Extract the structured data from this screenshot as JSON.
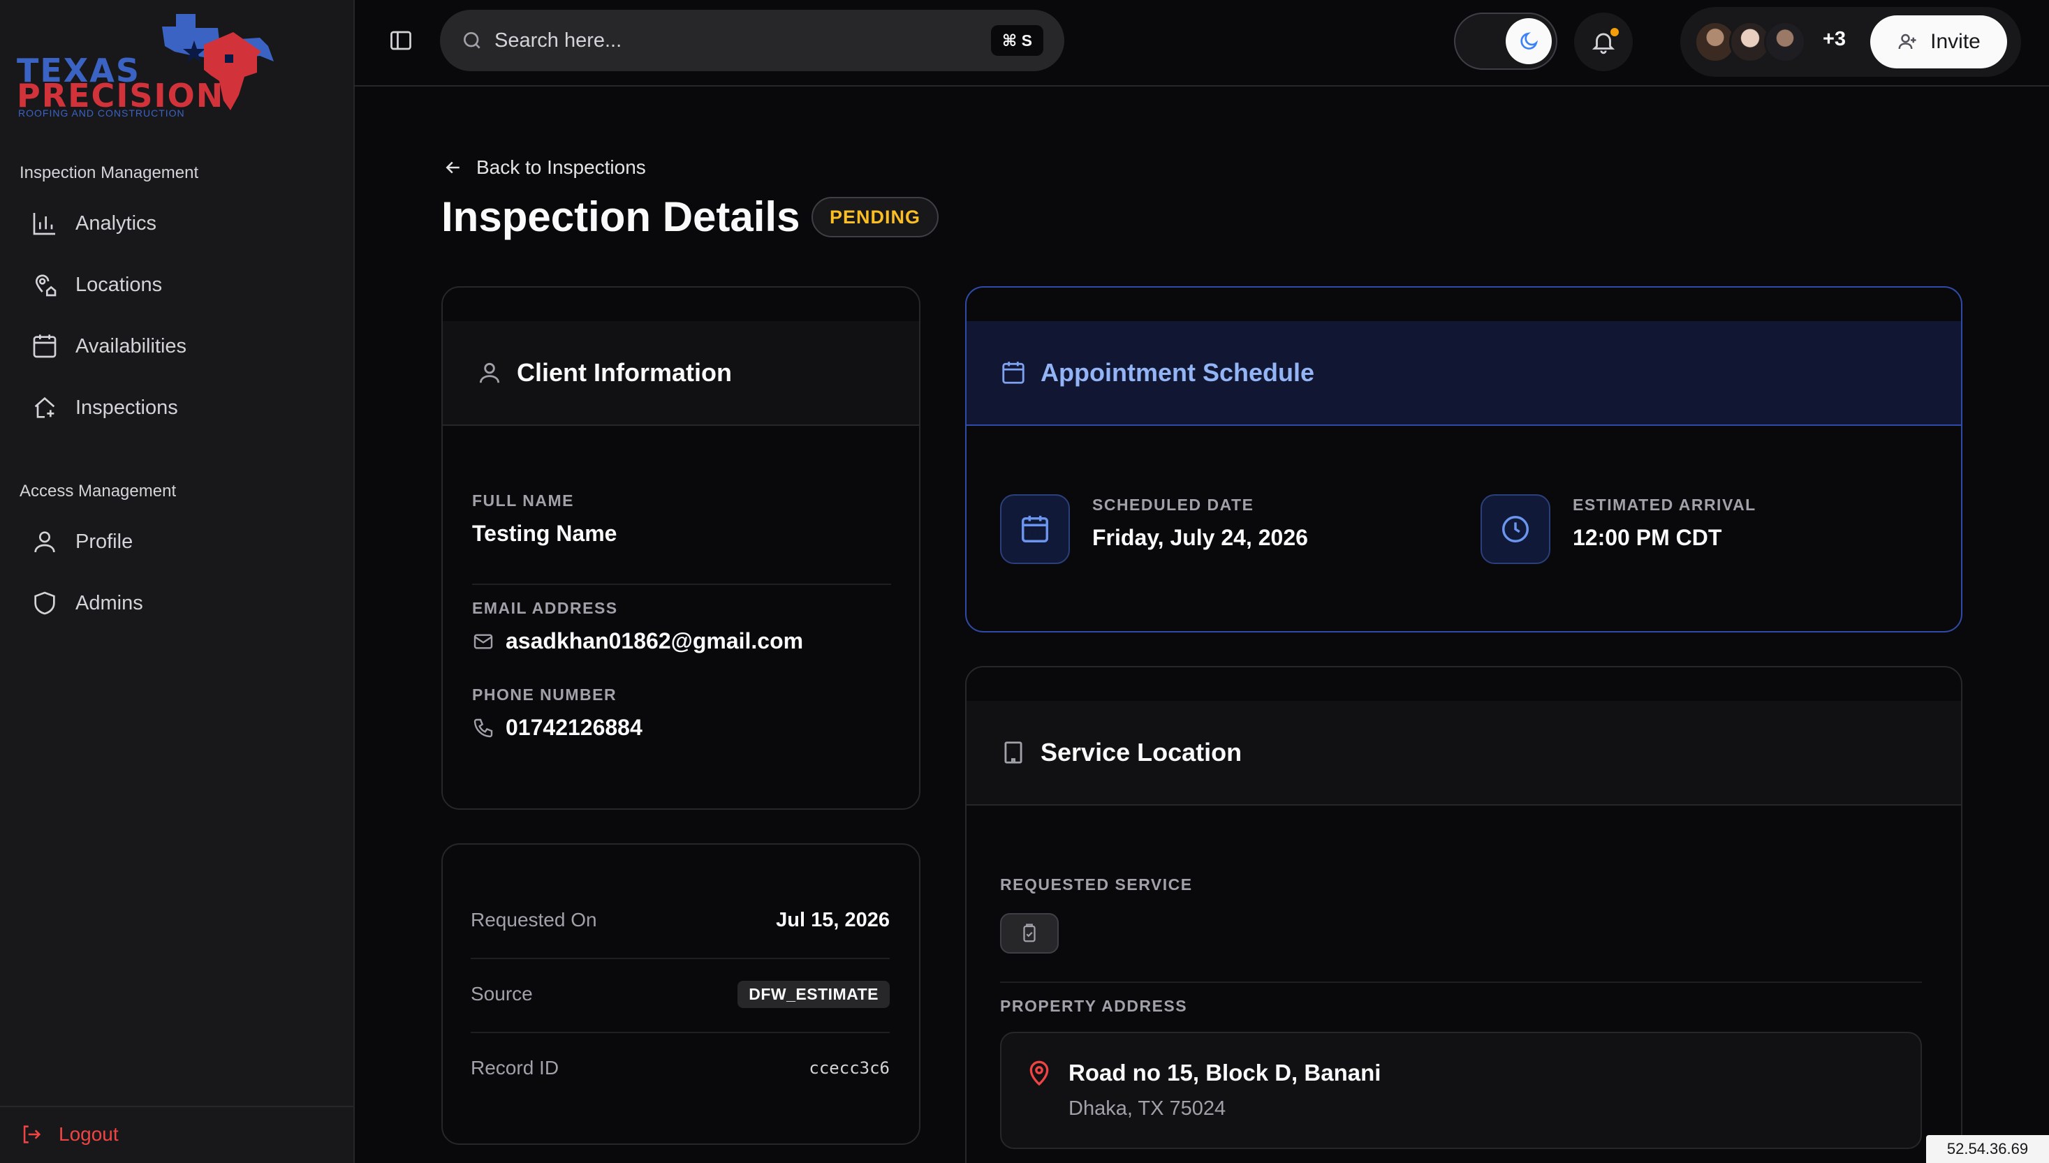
{
  "brand": {
    "line1": "TEXAS",
    "line2": "PRECISION",
    "tagline": "ROOFING AND CONSTRUCTION"
  },
  "sidebar": {
    "sections": [
      {
        "label": "Inspection Management",
        "items": [
          {
            "label": "Analytics",
            "icon": "bar-chart-icon"
          },
          {
            "label": "Locations",
            "icon": "map-pin-house-icon"
          },
          {
            "label": "Availabilities",
            "icon": "calendar-icon"
          },
          {
            "label": "Inspections",
            "icon": "house-plus-icon"
          }
        ]
      },
      {
        "label": "Access Management",
        "items": [
          {
            "label": "Profile",
            "icon": "user-icon"
          },
          {
            "label": "Admins",
            "icon": "shield-icon"
          }
        ]
      }
    ],
    "logout_label": "Logout"
  },
  "header": {
    "search_placeholder": "Search here...",
    "search_shortcut": "⌘ S",
    "team_more": "+3",
    "invite_label": "Invite"
  },
  "page": {
    "back_label": "Back to Inspections",
    "title": "Inspection Details",
    "status": "PENDING"
  },
  "client": {
    "title": "Client Information",
    "full_name_label": "FULL NAME",
    "full_name": "Testing Name",
    "email_label": "EMAIL ADDRESS",
    "email": "asadkhan01862@gmail.com",
    "phone_label": "PHONE NUMBER",
    "phone": "01742126884"
  },
  "meta": {
    "requested_on_label": "Requested On",
    "requested_on": "Jul 15, 2026",
    "source_label": "Source",
    "source": "DFW_ESTIMATE",
    "record_id_label": "Record ID",
    "record_id": "ccecc3c6"
  },
  "appointment": {
    "title": "Appointment Schedule",
    "date_label": "SCHEDULED DATE",
    "date": "Friday, July 24, 2026",
    "arrival_label": "ESTIMATED ARRIVAL",
    "arrival": "12:00 PM CDT"
  },
  "location": {
    "title": "Service Location",
    "requested_service_label": "REQUESTED SERVICE",
    "property_address_label": "PROPERTY ADDRESS",
    "address_line1": "Road no 15, Block D, Banani",
    "address_line2": "Dhaka, TX 75024"
  },
  "footer": {
    "ip": "52.54.36.69"
  },
  "colors": {
    "status_pending": "#fbbf24",
    "accent_blue": "#93b4f5",
    "danger": "#ef4444",
    "brand_blue": "#3b63c4",
    "brand_red": "#d2323a"
  }
}
